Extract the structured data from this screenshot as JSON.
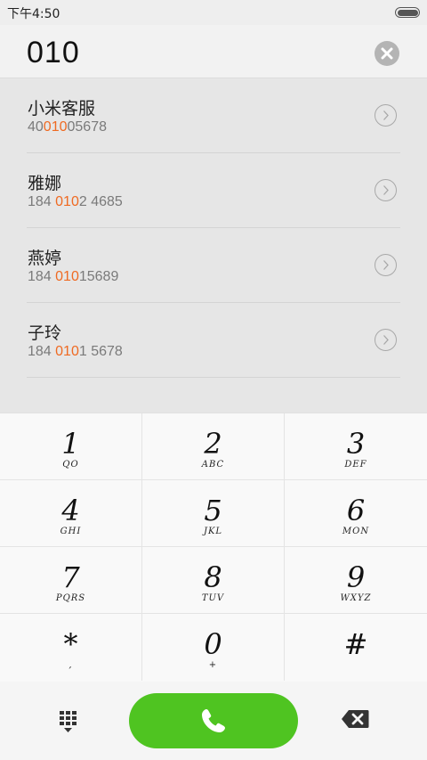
{
  "status_bar": {
    "time": "下午4:50"
  },
  "number_display": {
    "value": "010"
  },
  "results": [
    {
      "name": "小米客服",
      "number_pre": "40",
      "number_match": "010",
      "number_post": "05678"
    },
    {
      "name": "雅娜",
      "number_pre": "184 ",
      "number_match": "010",
      "number_post": "2 4685"
    },
    {
      "name": "燕婷",
      "number_pre": "184 ",
      "number_match": "010",
      "number_post": "15689"
    },
    {
      "name": "子玲",
      "number_pre": "184 ",
      "number_match": "010",
      "number_post": "1 5678"
    }
  ],
  "keypad": {
    "keys": [
      {
        "digit": "1",
        "letters": "QO"
      },
      {
        "digit": "2",
        "letters": "ABC"
      },
      {
        "digit": "3",
        "letters": "DEF"
      },
      {
        "digit": "4",
        "letters": "GHI"
      },
      {
        "digit": "5",
        "letters": "JKL"
      },
      {
        "digit": "6",
        "letters": "MON"
      },
      {
        "digit": "7",
        "letters": "PQRS"
      },
      {
        "digit": "8",
        "letters": "TUV"
      },
      {
        "digit": "9",
        "letters": "WXYZ"
      },
      {
        "digit": "*",
        "letters": ","
      },
      {
        "digit": "0",
        "letters": "+"
      },
      {
        "digit": "#",
        "letters": ""
      }
    ]
  },
  "icons": {
    "clear": "close-circle-icon",
    "detail": "chevron-right-circle-icon",
    "dialpad": "dialpad-icon",
    "call": "phone-icon",
    "backspace": "backspace-icon"
  },
  "colors": {
    "highlight": "#ef6a22",
    "call_button": "#4fc421"
  }
}
